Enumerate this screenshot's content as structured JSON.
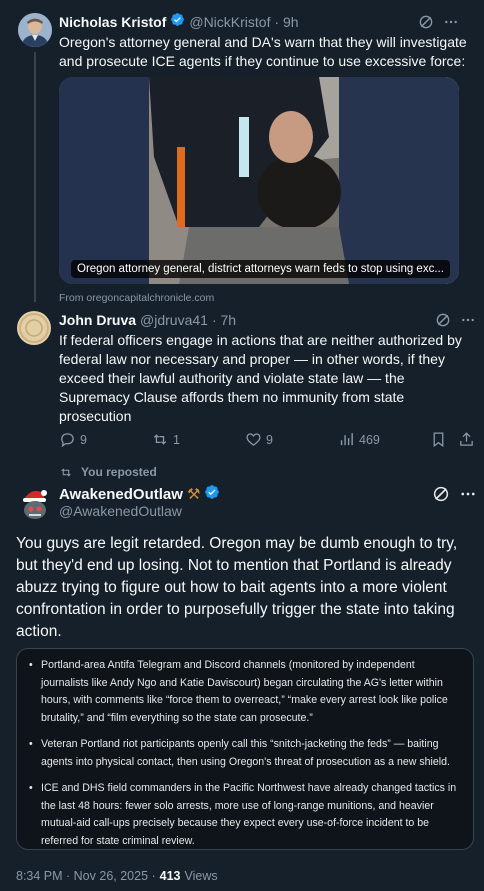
{
  "tweet1": {
    "name": "Nicholas Kristof",
    "handle": "@NickKristof",
    "time": "· 9h",
    "text": "Oregon's attorney general and DA's warn that they will investigate and prosecute ICE agents if they continue to use excessive force:",
    "media_caption": "Oregon attorney general, district attorneys warn feds to stop using exc...",
    "source": "From oregoncapitalchronicle.com"
  },
  "tweet2": {
    "name": "John Druva",
    "handle": "@jdruva41",
    "time": "· 7h",
    "text": "If federal officers engage in actions that are neither authorized by federal law nor necessary and proper — in other words, if they exceed their lawful authority and violate state law — the Supremacy Clause affords them no immunity from state prosecution",
    "actions": {
      "replies": "9",
      "reposts": "1",
      "likes": "9",
      "views": "469"
    }
  },
  "repost_label": "You reposted",
  "main_tweet": {
    "name": "AwakenedOutlaw",
    "name_emoji": "⚒",
    "handle": "@AwakenedOutlaw",
    "text": "You guys are legit retarded.   Oregon may be dumb enough to try, but they'd end up losing.  Not to mention that Portland is already abuzz trying to figure out how to bait agents into a more violent confrontation in order to purposefully trigger the state into taking action.",
    "bullets": [
      "Portland-area Antifa Telegram and Discord channels (monitored by independent journalists like Andy Ngo and Katie Daviscourt) began circulating the AG's letter within hours, with comments like “force them to overreact,” “make every arrest look like police brutality,” and “film everything so the state can prosecute.”",
      "Veteran Portland riot participants openly call this “snitch-jacketing the feds” — baiting agents into physical contact, then using Oregon's threat of prosecution as a new shield.",
      "ICE and DHS field commanders in the Pacific Northwest have already changed tactics in the last 48 hours: fewer solo arrests, more use of long-range munitions, and heavier mutual-aid call-ups precisely because they expect every use-of-force incident to be referred for state criminal review."
    ],
    "timestamp": "8:34 PM · Nov 26, 2025 ·",
    "views_count": "413",
    "views_label": "Views"
  },
  "colors": {
    "background": "#15202b",
    "muted": "#8b98a5",
    "verified": "#1d9bf0",
    "thread_line": "#38444d"
  }
}
